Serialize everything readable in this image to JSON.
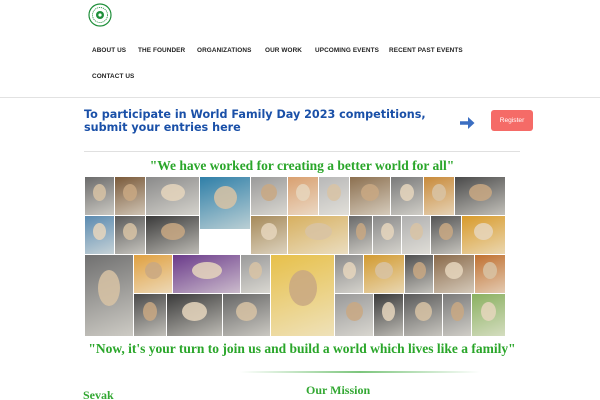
{
  "header": {
    "nav": [
      {
        "label": "ABOUT US"
      },
      {
        "label": "THE FOUNDER"
      },
      {
        "label": "ORGANIZATIONS"
      },
      {
        "label": "OUR WORK"
      },
      {
        "label": "UPCOMING EVENTS"
      },
      {
        "label": "RECENT PAST EVENTS"
      },
      {
        "label": "CONTACT US"
      }
    ]
  },
  "banner": {
    "text": "To participate in World Family Day 2023 competitions, submit your entries here",
    "register_label": "Register",
    "arrow_icon": "arrow-right-icon"
  },
  "hero": {
    "quote_top": "\"We have worked for creating a better world for all\"",
    "quote_bottom": "\"Now, it's your turn to join us and build a world which lives like a family\""
  },
  "sections": {
    "left_heading": "Sevak",
    "right_heading": "Our Mission"
  },
  "colors": {
    "accent_blue": "#1a50a8",
    "register_red": "#f56b67",
    "quote_green": "#2aa62a"
  }
}
